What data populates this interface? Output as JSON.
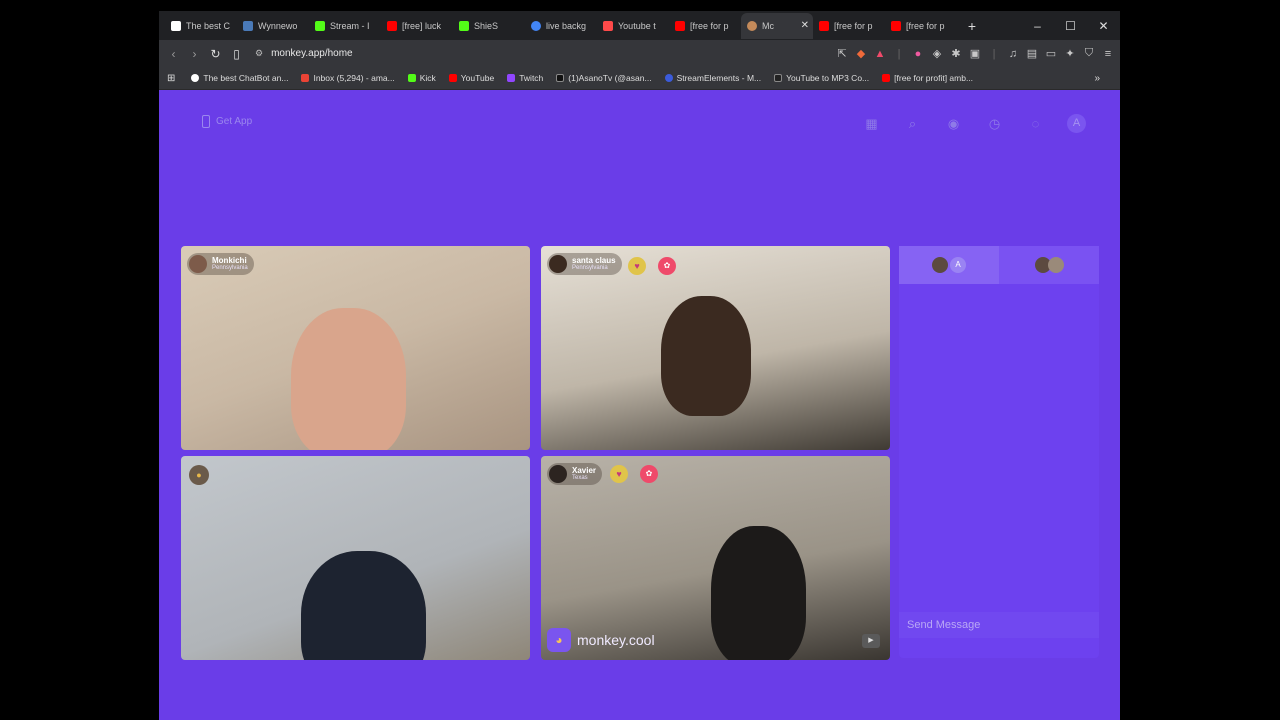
{
  "browser": {
    "tabs": [
      {
        "label": "The best C",
        "color": "#ffffff",
        "active": false
      },
      {
        "label": "Wynnewo",
        "color": "#4a7ab8",
        "active": false
      },
      {
        "label": "Stream - I",
        "color": "#53fc18",
        "active": false
      },
      {
        "label": "[free] luck",
        "color": "#ff0000",
        "active": false
      },
      {
        "label": "ShieS",
        "color": "#53fc18",
        "active": false
      },
      {
        "label": "live backg",
        "color": "#4285f4",
        "active": false
      },
      {
        "label": "Youtube t",
        "color": "#ff4a4a",
        "active": false
      },
      {
        "label": "[free for p",
        "color": "#ff0000",
        "active": false
      },
      {
        "label": "Mc",
        "color": "#c48a5a",
        "active": true
      },
      {
        "label": "[free for p",
        "color": "#ff0000",
        "active": false
      },
      {
        "label": "[free for p",
        "color": "#ff0000",
        "active": false
      }
    ],
    "url": "monkey.app/home",
    "bookmarks": [
      {
        "label": "The best ChatBot an...",
        "color": "#ffffff"
      },
      {
        "label": "Inbox (5,294) - ama...",
        "color": "#ea4335"
      },
      {
        "label": "Kick",
        "color": "#53fc18"
      },
      {
        "label": "YouTube",
        "color": "#ff0000"
      },
      {
        "label": "Twitch",
        "color": "#9146ff"
      },
      {
        "label": "(1)AsanoTv (@asan...",
        "color": "#111111"
      },
      {
        "label": "StreamElements - M...",
        "color": "#3b5bdb"
      },
      {
        "label": "YouTube to MP3 Co...",
        "color": "#222222"
      },
      {
        "label": "[free for profit] amb...",
        "color": "#ff0000"
      }
    ]
  },
  "app": {
    "get_app": "Get App",
    "profile_initial": "A",
    "tiles": [
      {
        "name": "Monkichi",
        "location": "Pennsylvania"
      },
      {
        "name": "santa claus",
        "location": "Pennsylvania"
      },
      {
        "name": "",
        "location": ""
      },
      {
        "name": "Xavier",
        "location": "Texas"
      }
    ],
    "watermark": "monkey.cool",
    "chat": {
      "tab_initial": "A",
      "placeholder": "Send Message"
    }
  }
}
